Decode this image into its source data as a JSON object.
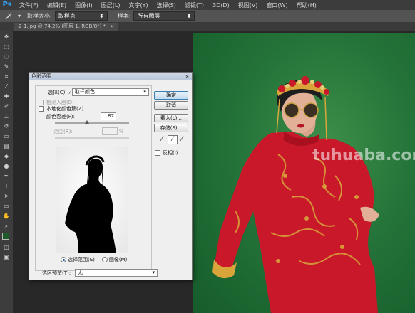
{
  "app": {
    "logo": "Ps"
  },
  "menu": [
    "文件(F)",
    "编辑(E)",
    "图像(I)",
    "图层(L)",
    "文字(Y)",
    "选择(S)",
    "滤镜(T)",
    "3D(D)",
    "视图(V)",
    "窗口(W)",
    "帮助(H)"
  ],
  "options_bar": {
    "tool_icon": "eyedropper-icon",
    "sample_size_label": "取样大小:",
    "sample_size_value": "取样点",
    "sample_label": "样本:",
    "sample_value": "所有图层"
  },
  "document_tab": {
    "title": "2-1.jpg @ 74.2% (图层 1, RGB/8*) *",
    "close": "×"
  },
  "dialog": {
    "title": "色彩范围",
    "select_label": "选择(C):",
    "select_value": "取样颜色",
    "detect_faces": "检测人脸(D)",
    "localized_clusters": "本地化颜色簇(Z)",
    "fuzziness_label": "颜色容差(F):",
    "fuzziness_value": "87",
    "range_label": "范围(R):",
    "range_unit": "%",
    "radio_selection": "选择范围(E)",
    "radio_image": "图像(M)",
    "preview_label": "选区预览(T):",
    "preview_value": "无",
    "buttons": {
      "ok": "确定",
      "cancel": "取消",
      "load": "载入(L)...",
      "save": "存储(S)..."
    },
    "invert_label": "反相(I)",
    "close": "×"
  },
  "watermark": "tuhuaba.com",
  "colors": {
    "accent": "#31a8ff",
    "photo_bg": "#25743a",
    "dress_red": "#c8182a",
    "gold": "#d9a53a"
  }
}
